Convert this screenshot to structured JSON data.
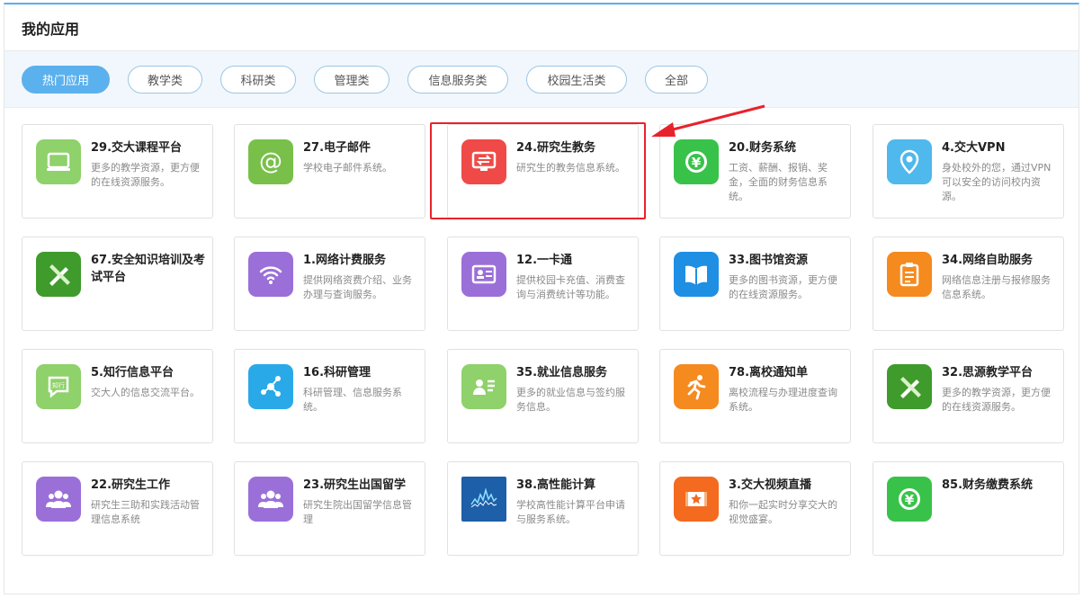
{
  "header": {
    "title": "我的应用"
  },
  "tabs": [
    {
      "label": "热门应用",
      "active": true
    },
    {
      "label": "教学类",
      "active": false
    },
    {
      "label": "科研类",
      "active": false
    },
    {
      "label": "管理类",
      "active": false
    },
    {
      "label": "信息服务类",
      "active": false
    },
    {
      "label": "校园生活类",
      "active": false
    },
    {
      "label": "全部",
      "active": false
    }
  ],
  "apps": [
    {
      "name": "29.交大课程平台",
      "desc": "更多的教学资源，更方便的在线资源服务。",
      "icon": "monitor-icon",
      "color": "#8fd16a"
    },
    {
      "name": "27.电子邮件",
      "desc": "学校电子邮件系统。",
      "icon": "at-icon",
      "color": "#79c04a"
    },
    {
      "name": "24.研究生教务",
      "desc": "研究生的教务信息系统。",
      "icon": "screen-transfer-icon",
      "color": "#ef4a47"
    },
    {
      "name": "20.财务系统",
      "desc": "工资、薪酬、报销、奖金，全面的财务信息系统。",
      "icon": "yen-icon",
      "color": "#39c24a"
    },
    {
      "name": "4.交大VPN",
      "desc": "身处校外的您，通过VPN可以安全的访问校内资源。",
      "icon": "location-pin-icon",
      "color": "#4fb8ec"
    },
    {
      "name": "67.安全知识培训及考试平台",
      "desc": "",
      "icon": "pencil-ruler-icon",
      "color": "#3f9b2c"
    },
    {
      "name": "1.网络计费服务",
      "desc": "提供网络资费介绍、业务办理与查询服务。",
      "icon": "wifi-icon",
      "color": "#9b6fd8"
    },
    {
      "name": "12.一卡通",
      "desc": "提供校园卡充值、消费查询与消费统计等功能。",
      "icon": "id-card-icon",
      "color": "#9b6fd8"
    },
    {
      "name": "33.图书馆资源",
      "desc": "更多的图书资源，更方便的在线资源服务。",
      "icon": "book-icon",
      "color": "#1e8fe3"
    },
    {
      "name": "34.网络自助服务",
      "desc": "网络信息注册与报修服务信息系统。",
      "icon": "clipboard-icon",
      "color": "#f58a1f"
    },
    {
      "name": "5.知行信息平台",
      "desc": "交大人的信息交流平台。",
      "icon": "chat-bubble-icon",
      "color": "#8fd16a"
    },
    {
      "name": "16.科研管理",
      "desc": "科研管理、信息服务系统。",
      "icon": "molecule-icon",
      "color": "#29a9e8"
    },
    {
      "name": "35.就业信息服务",
      "desc": "更多的就业信息与签约服务信息。",
      "icon": "resume-icon",
      "color": "#8fd16a"
    },
    {
      "name": "78.离校通知单",
      "desc": "离校流程与办理进度查询系统。",
      "icon": "runner-icon",
      "color": "#f58a1f"
    },
    {
      "name": "32.思源教学平台",
      "desc": "更多的教学资源，更方便的在线资源服务。",
      "icon": "pencil-ruler-icon",
      "color": "#3f9b2c"
    },
    {
      "name": "22.研究生工作",
      "desc": "研究生三助和实践活动管理信息系统",
      "icon": "users-icon",
      "color": "#9b6fd8"
    },
    {
      "name": "23.研究生出国留学",
      "desc": "研究生院出国留学信息管理",
      "icon": "users-icon",
      "color": "#9b6fd8"
    },
    {
      "name": "38.高性能计算",
      "desc": "学校高性能计算平台申请与服务系统。",
      "icon": "line-chart-icon",
      "color": "#1d5fa8"
    },
    {
      "name": "3.交大视频直播",
      "desc": "和你一起实时分享交大的视觉盛宴。",
      "icon": "film-star-icon",
      "color": "#f46a1f"
    },
    {
      "name": "85.财务缴费系统",
      "desc": "",
      "icon": "yen-icon",
      "color": "#39c24a"
    }
  ],
  "annotation": {
    "highlight_color": "#e8222b",
    "highlighted_app": "24.研究生教务"
  }
}
